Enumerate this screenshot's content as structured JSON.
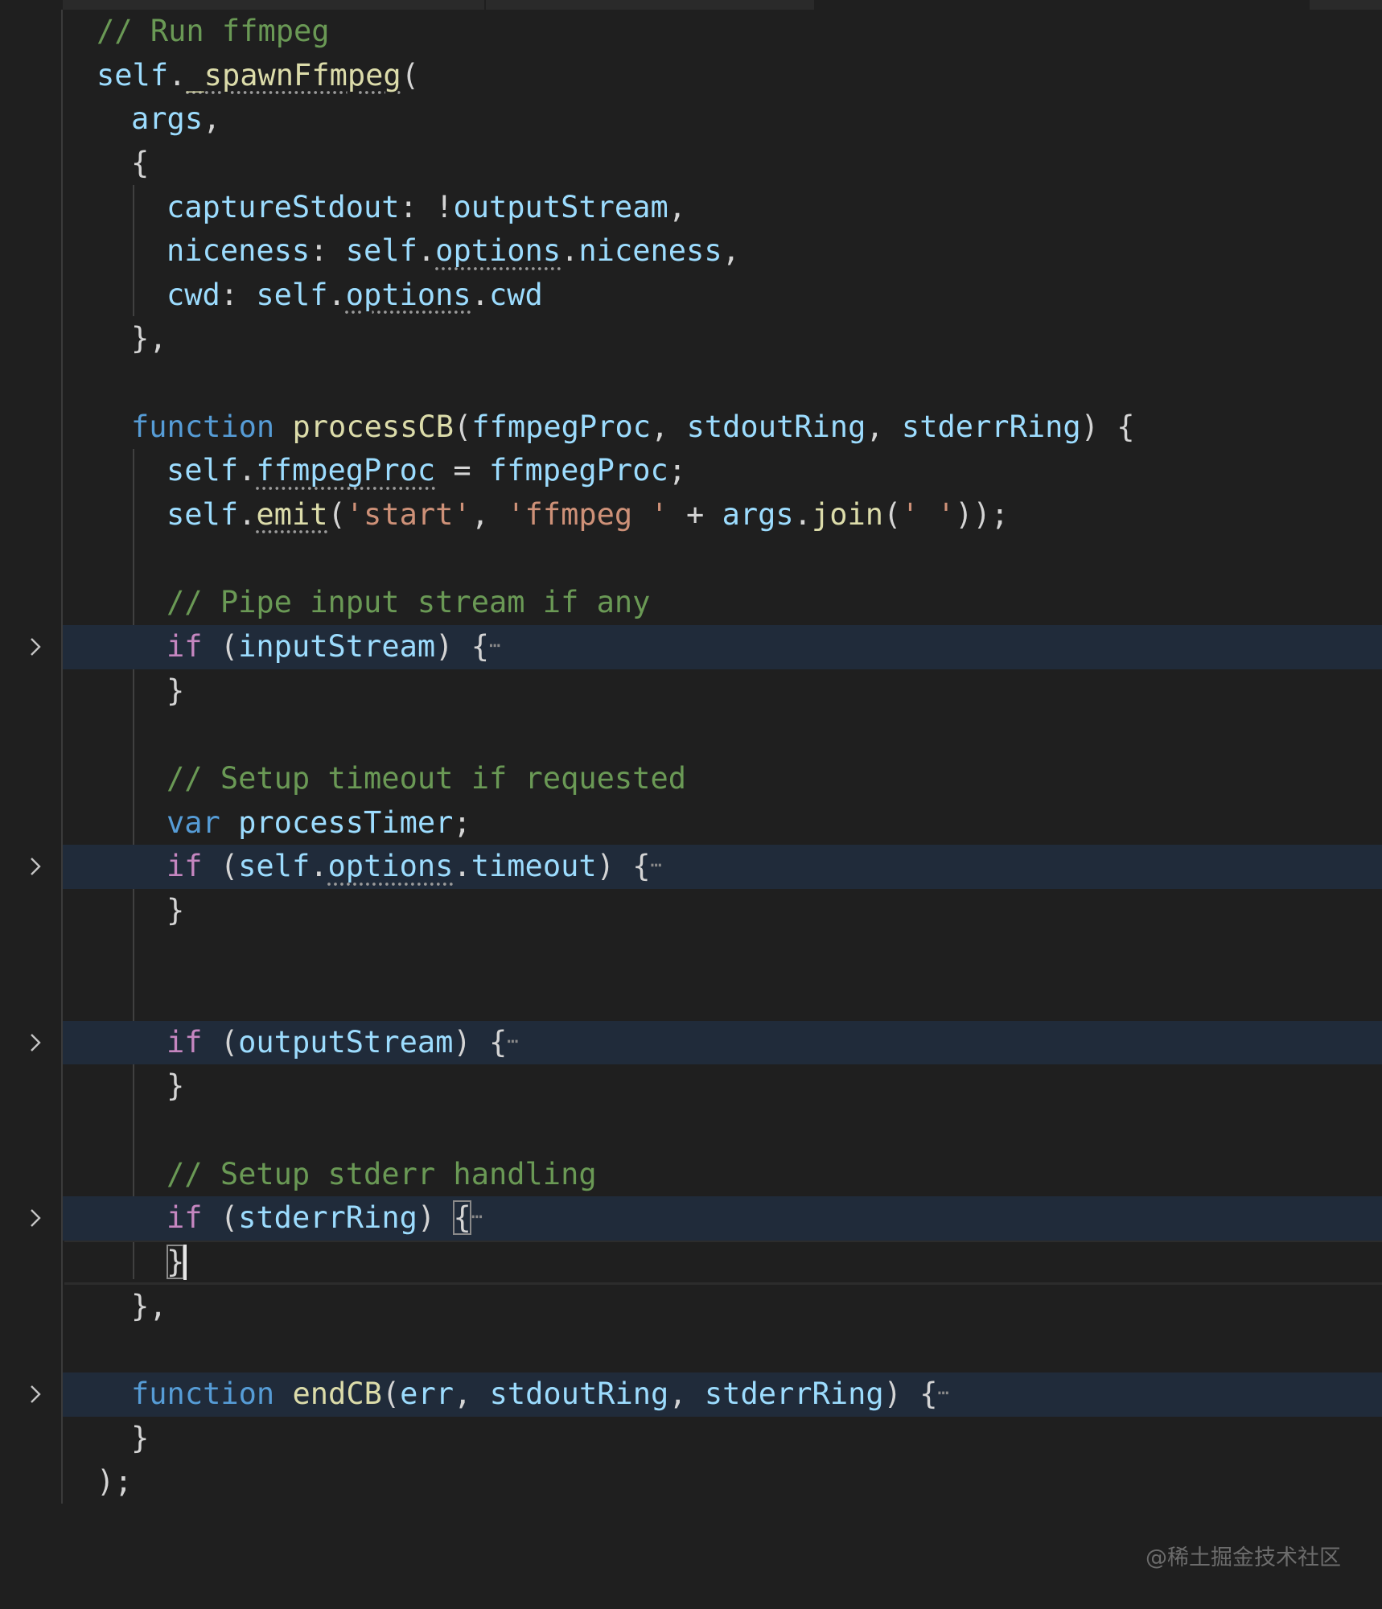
{
  "editor": {
    "lines": {
      "l1": {
        "comment": "// Run ffmpeg"
      },
      "l2": {
        "obj": "self",
        "dot": ".",
        "method": "_spawnFfmpeg",
        "paren": "("
      },
      "l3": {
        "text": "args",
        "punct": ","
      },
      "l4": {
        "brace": "{"
      },
      "l5": {
        "key": "captureStdout",
        "colon": ": ",
        "bang": "!",
        "val": "outputStream",
        "punct": ","
      },
      "l6": {
        "key": "niceness",
        "colon": ": ",
        "obj": "self",
        "dot1": ".",
        "prop1": "options",
        "dot2": ".",
        "prop2": "niceness",
        "punct": ","
      },
      "l7": {
        "key": "cwd",
        "colon": ": ",
        "obj": "self",
        "dot1": ".",
        "prop1": "options",
        "dot2": ".",
        "prop2": "cwd"
      },
      "l8": {
        "brace": "},"
      },
      "l10": {
        "kw": "function",
        "name": "processCB",
        "open": "(",
        "p1": "ffmpegProc",
        "c1": ", ",
        "p2": "stdoutRing",
        "c2": ", ",
        "p3": "stderrRing",
        "close": ") {"
      },
      "l11": {
        "obj": "self",
        "dot": ".",
        "prop": "ffmpegProc",
        "op": " = ",
        "val": "ffmpegProc",
        "semi": ";"
      },
      "l12": {
        "obj": "self",
        "dot": ".",
        "method": "emit",
        "open": "(",
        "s1": "'start'",
        "c1": ", ",
        "s2": "'ffmpeg '",
        "op": " + ",
        "v": "args",
        "dot2": ".",
        "m2": "join",
        "open2": "(",
        "s3": "' '",
        "close": "));"
      },
      "l14": {
        "comment": "// Pipe input stream if any"
      },
      "l15": {
        "kw": "if",
        "open": " (",
        "cond": "inputStream",
        "close": ") {",
        "ellipsis": "⋯"
      },
      "l16": {
        "brace": "}"
      },
      "l18": {
        "comment": "// Setup timeout if requested"
      },
      "l19": {
        "kw": "var",
        "name": "processTimer",
        "semi": ";"
      },
      "l20": {
        "kw": "if",
        "open": " (",
        "obj": "self",
        "dot1": ".",
        "prop1": "options",
        "dot2": ".",
        "prop2": "timeout",
        "close": ") {",
        "ellipsis": "⋯"
      },
      "l21": {
        "brace": "}"
      },
      "l24": {
        "kw": "if",
        "open": " (",
        "cond": "outputStream",
        "close": ") {",
        "ellipsis": "⋯"
      },
      "l25": {
        "brace": "}"
      },
      "l27": {
        "comment": "// Setup stderr handling"
      },
      "l28": {
        "kw": "if",
        "open": " (",
        "cond": "stderrRing",
        "close": ") ",
        "brace": "{",
        "ellipsis": "⋯"
      },
      "l29": {
        "brace": "}"
      },
      "l30": {
        "brace": "},"
      },
      "l32": {
        "kw": "function",
        "name": "endCB",
        "open": "(",
        "p1": "err",
        "c1": ", ",
        "p2": "stdoutRing",
        "c2": ", ",
        "p3": "stderrRing",
        "close": ") {",
        "ellipsis": "⋯"
      },
      "l33": {
        "brace": "}"
      },
      "l34": {
        "text": ");"
      }
    },
    "fold_icon": "chevron-right-icon"
  },
  "watermark": "@稀土掘金技术社区",
  "colors": {
    "background": "#1f1f1f",
    "comment": "#6a9955",
    "keyword": "#569cd6",
    "control": "#c586c0",
    "function": "#dcdcaa",
    "string": "#ce9178",
    "variable": "#9cdcfe",
    "fold_highlight": "#202b3a"
  }
}
